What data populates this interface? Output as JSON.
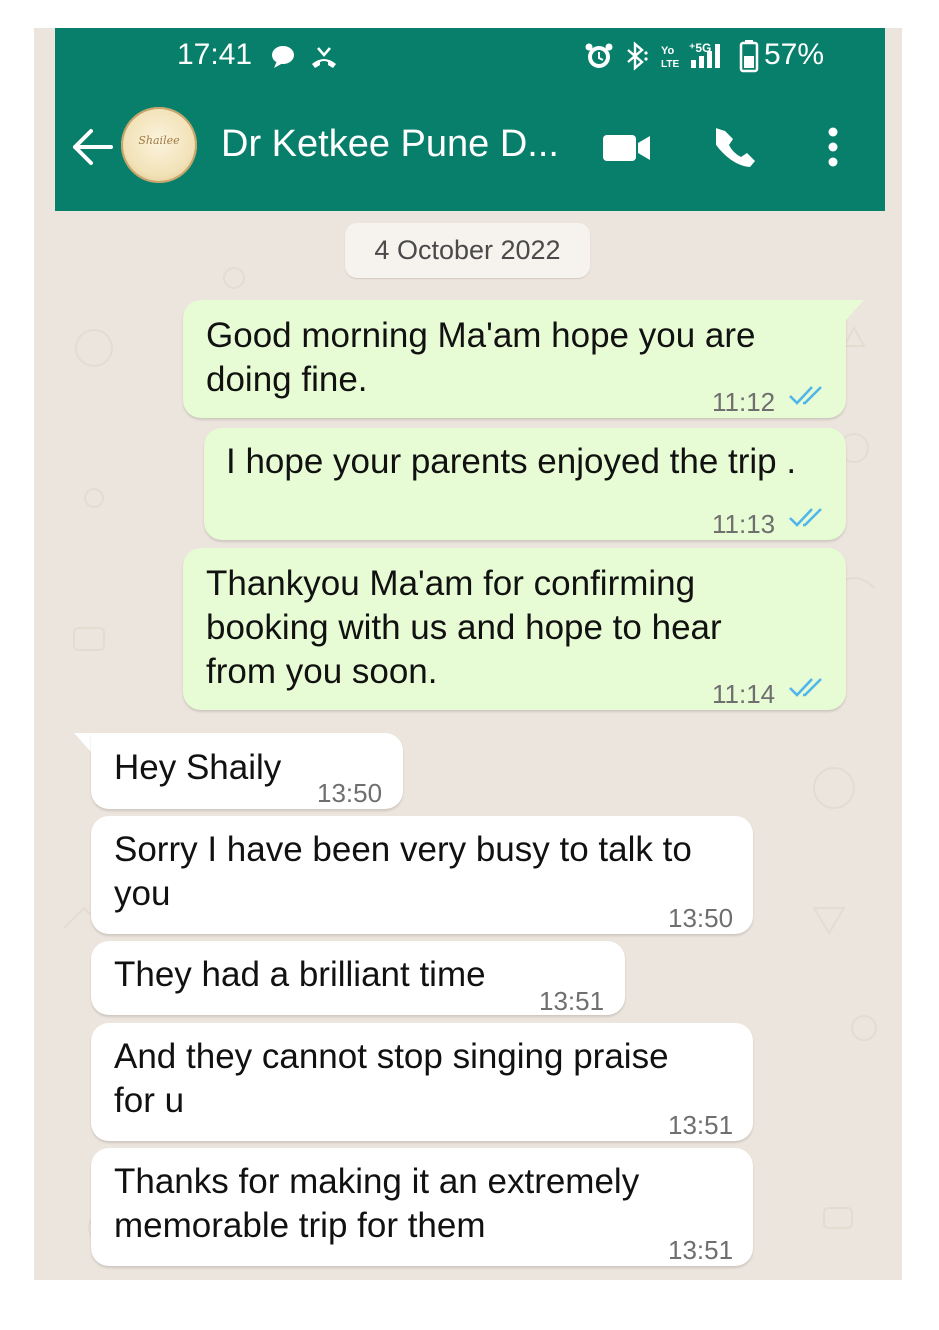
{
  "status_bar": {
    "time": "17:41",
    "battery": "57%"
  },
  "header": {
    "contact_name": "Dr Ketkee Pune D...",
    "avatar_text": "Shailee"
  },
  "date_chip": "4 October 2022",
  "messages": [
    {
      "direction": "outgoing",
      "text": "Good morning Ma'am hope you are\ndoing fine.",
      "time": "11:12",
      "status": "read"
    },
    {
      "direction": "outgoing",
      "text": "I hope your parents enjoyed the trip .",
      "time": "11:13",
      "status": "read"
    },
    {
      "direction": "outgoing",
      "text": "Thankyou Ma'am for confirming\nbooking with us and hope to hear\nfrom you soon.",
      "time": "11:14",
      "status": "read"
    },
    {
      "direction": "incoming",
      "text": "Hey Shaily",
      "time": "13:50"
    },
    {
      "direction": "incoming",
      "text": "Sorry I have been very busy to talk to\nyou",
      "time": "13:50"
    },
    {
      "direction": "incoming",
      "text": "They had a brilliant time",
      "time": "13:51"
    },
    {
      "direction": "incoming",
      "text": "And they cannot stop singing praise\nfor u",
      "time": "13:51"
    },
    {
      "direction": "incoming",
      "text": "Thanks for making it an extremely\nmemorable trip for them",
      "time": "13:51"
    }
  ],
  "colors": {
    "header": "#087f6b",
    "outgoing_bubble": "#e7fcd4",
    "incoming_bubble": "#ffffff",
    "read_tick": "#4fb6ec",
    "chat_background": "#ece5dd"
  }
}
